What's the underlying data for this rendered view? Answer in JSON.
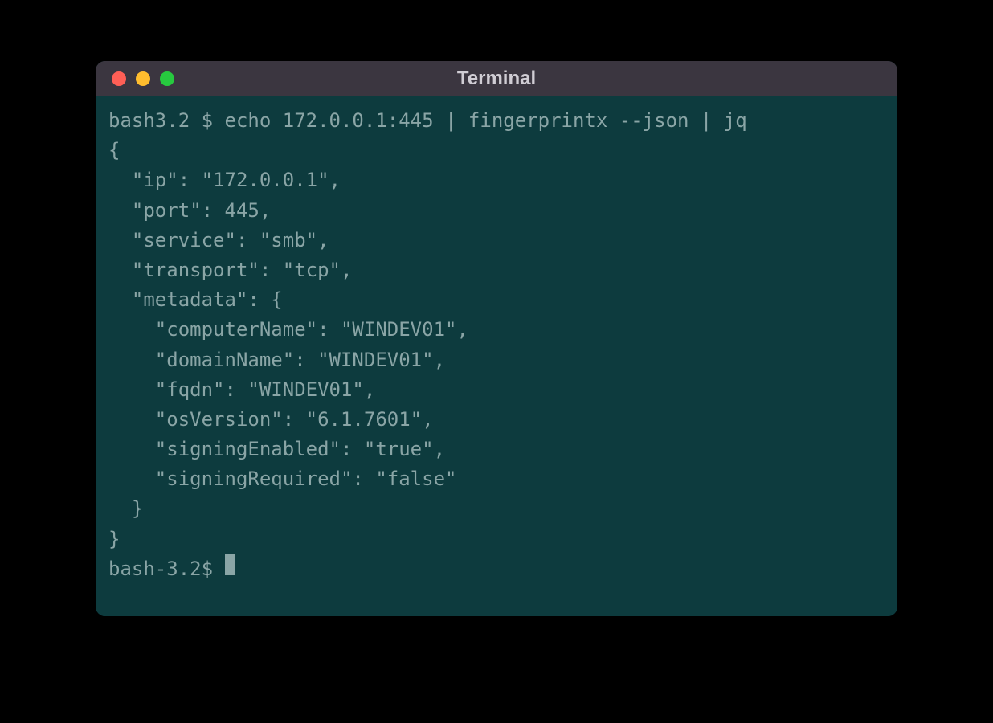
{
  "window": {
    "title": "Terminal"
  },
  "terminal": {
    "lines": [
      "bash3.2 $ echo 172.0.0.1:445 | fingerprintx --json | jq",
      "{",
      "  \"ip\": \"172.0.0.1\",",
      "  \"port\": 445,",
      "  \"service\": \"smb\",",
      "  \"transport\": \"tcp\",",
      "  \"metadata\": {",
      "    \"computerName\": \"WINDEV01\",",
      "    \"domainName\": \"WINDEV01\",",
      "    \"fqdn\": \"WINDEV01\",",
      "    \"osVersion\": \"6.1.7601\",",
      "    \"signingEnabled\": \"true\",",
      "    \"signingRequired\": \"false\"",
      "  }",
      "}"
    ],
    "current_prompt": "bash-3.2$ "
  }
}
